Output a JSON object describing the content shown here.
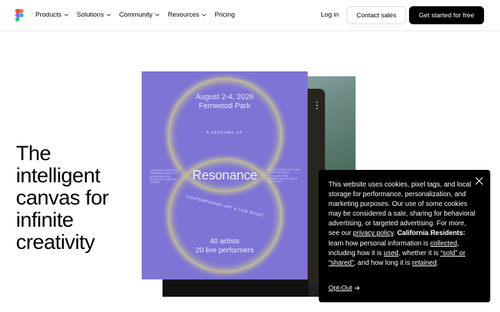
{
  "nav": {
    "menu": [
      {
        "label": "Products",
        "has_dropdown": true
      },
      {
        "label": "Solutions",
        "has_dropdown": true
      },
      {
        "label": "Community",
        "has_dropdown": true
      },
      {
        "label": "Resources",
        "has_dropdown": true
      },
      {
        "label": "Pricing",
        "has_dropdown": false
      }
    ],
    "login_label": "Log in",
    "contact_label": "Contact sales",
    "start_label": "Get started for free"
  },
  "hero": {
    "title": "The intelligent canvas for infinite creativity"
  },
  "poster": {
    "date": "August 2-4, 2026",
    "venue": "Fernwood Park",
    "festival_label": "A FESTIVAL OF",
    "title": "Resonance",
    "left_text": "CURATED WORKS BY EMERGING ARTISTS ALONGSIDE AN INTIMATE CONCERT SERIES",
    "right_text": "MUSIC VISUAL ART AND PERFORMANCE COLLIDE FREE ADMISSION ALL AGES WELCOME",
    "arc_text": "CONTEMPORARY ART & LIVE MUSIC",
    "artists": "40 artists",
    "performers": "20 live performers",
    "colors": {
      "background": "#7d74d6",
      "glow": "#c9c58e"
    }
  },
  "cookie": {
    "t1": "This website uses cookies, pixel tags, and local storage for performance, personalization, and marketing purposes. Our use of some cookies may be considered a sale, sharing for behavioral advertising, or targeted advertising. For more, see our ",
    "privacy_link": "privacy policy",
    "t2": ". ",
    "ca_bold": "California Residents:",
    "t3": " learn how personal information is ",
    "collected_link": "collected",
    "t4": ", including how it is ",
    "used_link": "used",
    "t5": ", whether it is ",
    "sold_link": "“sold” or “shared”",
    "t6": ", and how long it is ",
    "retained_link": "retained",
    "t7": ".",
    "opt_out": "Opt-Out",
    "close_icon": "close-icon"
  },
  "colors": {
    "primary_button": "#000000",
    "cookie_bg": "#000000"
  }
}
